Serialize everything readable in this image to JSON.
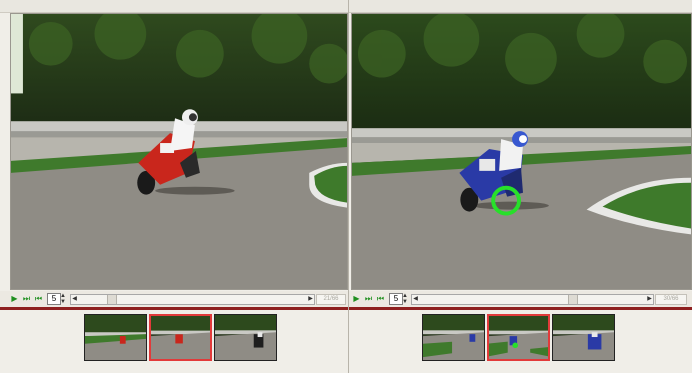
{
  "left_pane": {
    "frame_number": "5",
    "status_text": "21/66",
    "selected_thumb": 1
  },
  "right_pane": {
    "frame_number": "5",
    "status_text": "30/66",
    "selected_thumb": 1
  },
  "icons": {
    "play": "play-icon",
    "next": "step-forward-icon",
    "prev": "step-back-icon"
  },
  "colors": {
    "selection": "#e23a3a",
    "tracker": "#27e02a",
    "separator": "#8e2020"
  }
}
